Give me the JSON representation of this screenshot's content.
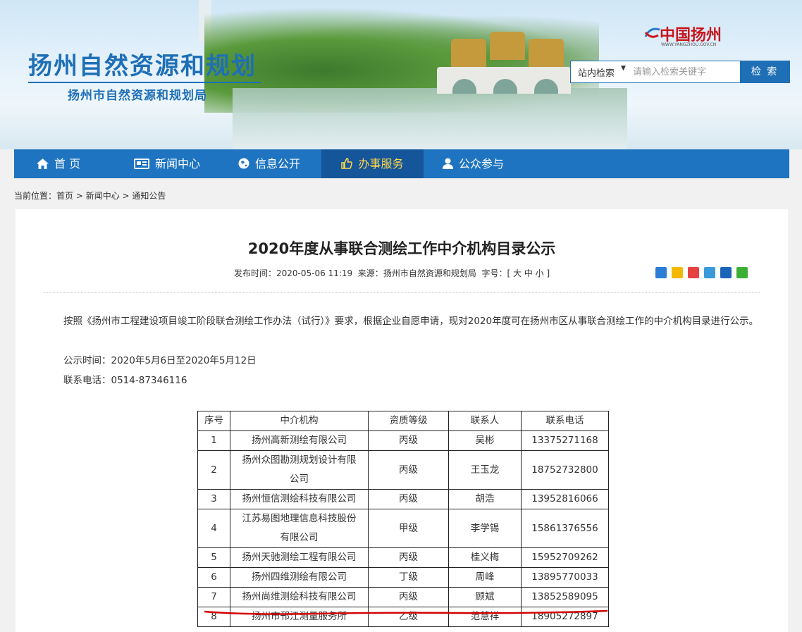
{
  "header": {
    "site_title": "扬州自然资源和规划",
    "site_subtitle": "扬州市自然资源和规划局",
    "logo_text": "中国扬州",
    "logo_url": "WWW.YANGZHOU.GOV.CN",
    "search_scope": "站内检索",
    "search_placeholder": "请输入检索关键字",
    "search_button": "检 索"
  },
  "nav": [
    {
      "label": "首 页",
      "icon": "home-icon"
    },
    {
      "label": "新闻中心",
      "icon": "newspaper-icon"
    },
    {
      "label": "信息公开",
      "icon": "globe-icon"
    },
    {
      "label": "办事服务",
      "icon": "thumbs-up-icon",
      "active": true
    },
    {
      "label": "公众参与",
      "icon": "user-icon"
    }
  ],
  "breadcrumb": {
    "prefix": "当前位置：",
    "items": [
      "首页",
      "新闻中心",
      "通知公告"
    ],
    "sep": " > "
  },
  "article": {
    "title": "2020年度从事联合测绘工作中介机构目录公示",
    "publish_label": "发布时间：",
    "publish_time": "2020-05-06 11:19",
    "source_label": "来源：",
    "source": "扬州市自然资源和规划局",
    "fontsize_label": "字号：[",
    "fontsize_large": "大",
    "fontsize_medium": "中",
    "fontsize_small": "小",
    "fontsize_end": "]",
    "paragraph1": "按照《扬州市工程建设项目竣工阶段联合测绘工作办法（试行）》要求，根据企业自愿申请，现对2020年度可在扬州市区从事联合测绘工作的中介机构目录进行公示。",
    "paragraph2": "公示时间：2020年5月6日至2020年5月12日",
    "paragraph3": "联系电话：0514-87346116"
  },
  "share_icons": [
    "plus-share-icon",
    "qzone-icon",
    "weibo-icon",
    "tencent-weibo-icon",
    "renren-icon",
    "wechat-icon"
  ],
  "table": {
    "headers": [
      "序号",
      "中介机构",
      "资质等级",
      "联系人",
      "联系电话"
    ],
    "rows": [
      {
        "no": "1",
        "org_l1": "扬州高新测绘有限公司",
        "org_l2": "",
        "level": "丙级",
        "contact": "吴彬",
        "phone": "13375271168"
      },
      {
        "no": "2",
        "org_l1": "扬州众图勘测规划设计有限",
        "org_l2": "公司",
        "level": "丙级",
        "contact": "王玉龙",
        "phone": "18752732800"
      },
      {
        "no": "3",
        "org_l1": "扬州恒信测绘科技有限公司",
        "org_l2": "",
        "level": "丙级",
        "contact": "胡浩",
        "phone": "13952816066"
      },
      {
        "no": "4",
        "org_l1": "江苏易图地理信息科技股份",
        "org_l2": "有限公司",
        "level": "甲级",
        "contact": "李学锡",
        "phone": "15861376556"
      },
      {
        "no": "5",
        "org_l1": "扬州天驰测绘工程有限公司",
        "org_l2": "",
        "level": "丙级",
        "contact": "桂义梅",
        "phone": "15952709262"
      },
      {
        "no": "6",
        "org_l1": "扬州四维测绘有限公司",
        "org_l2": "",
        "level": "丁级",
        "contact": "周峰",
        "phone": "13895770033"
      },
      {
        "no": "7",
        "org_l1": "扬州尚维测绘科技有限公司",
        "org_l2": "",
        "level": "丙级",
        "contact": "顾斌",
        "phone": "13852589095"
      },
      {
        "no": "8",
        "org_l1": "扬州市邗江测量服务所",
        "org_l2": "",
        "level": "乙级",
        "contact": "范慧祥",
        "phone": "18905272897"
      }
    ]
  },
  "colors": {
    "brand": "#1e74c0",
    "nav_active_text": "#ffd84a",
    "annotation": "#d40000"
  }
}
